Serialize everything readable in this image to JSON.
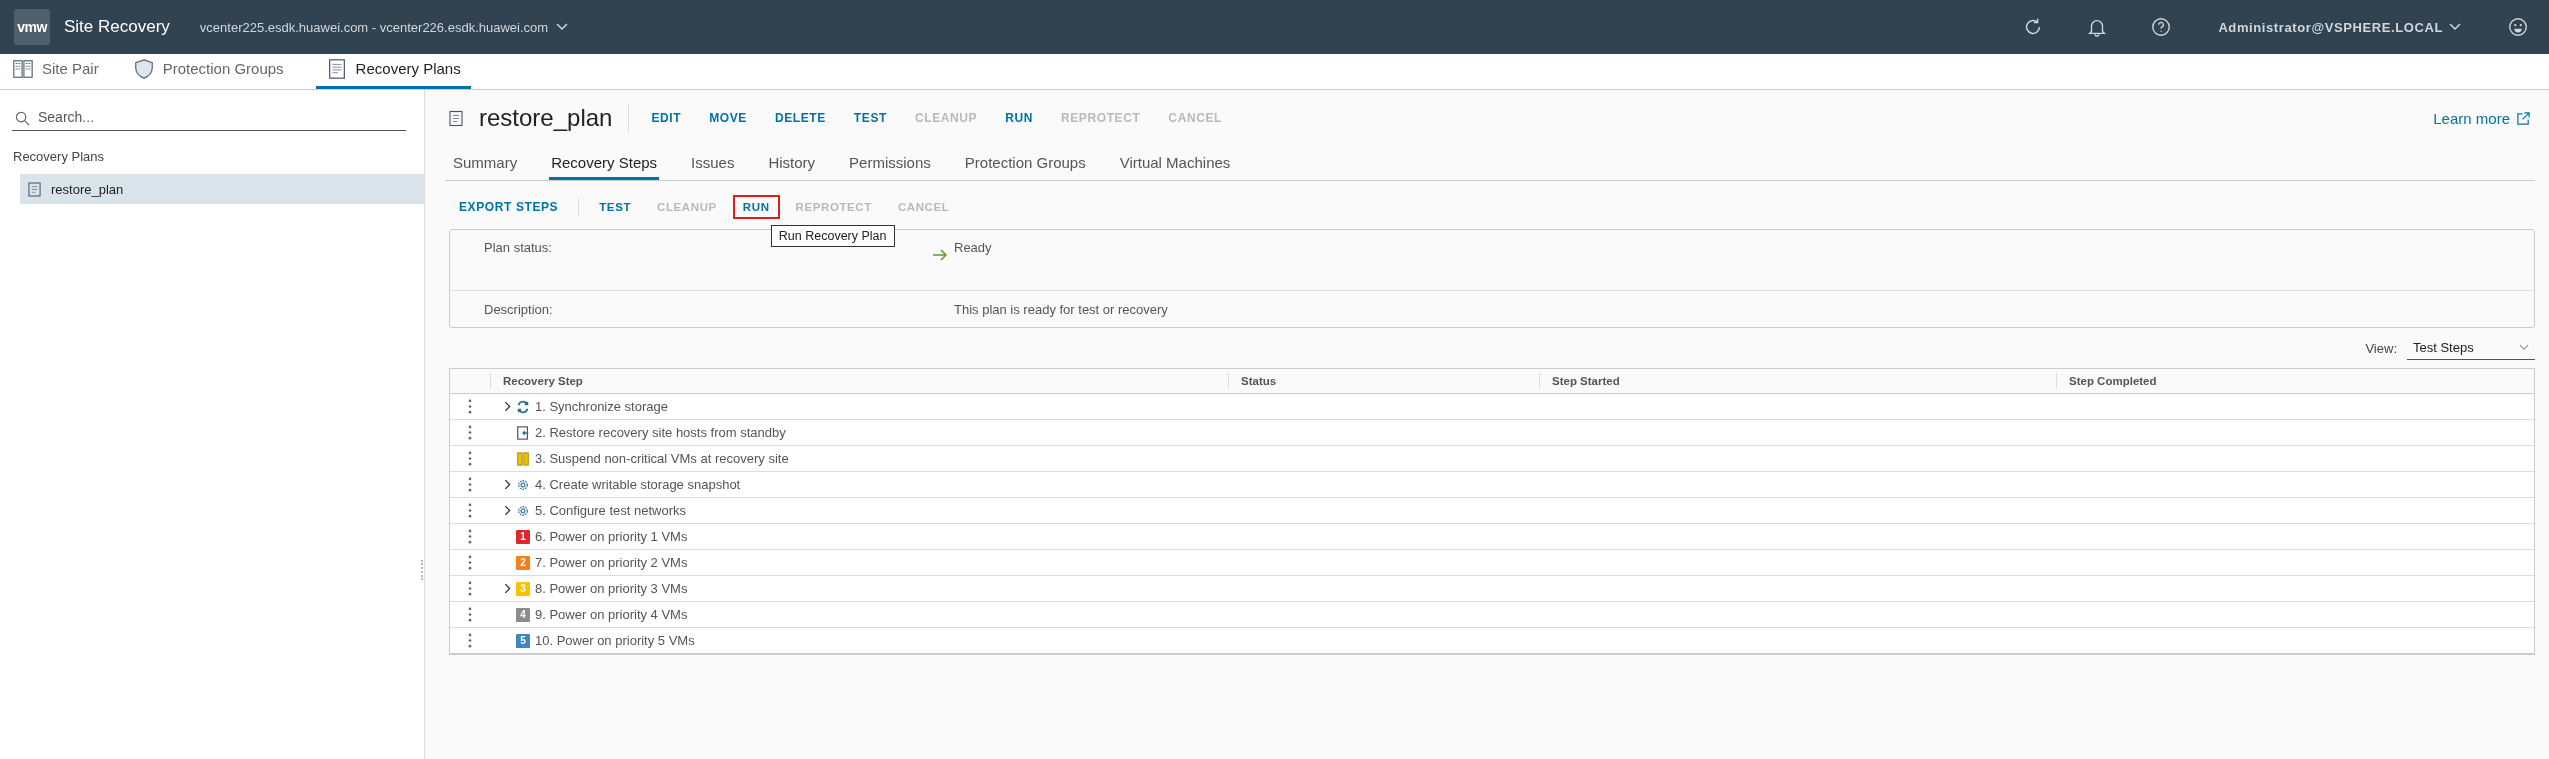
{
  "header": {
    "logo": "vmw",
    "app_title": "Site Recovery",
    "site_pair": "vcenter225.esdk.huawei.com - vcenter226.esdk.huawei.com",
    "user": "Administrator@VSPHERE.LOCAL"
  },
  "nav_tabs": [
    {
      "label": "Site Pair",
      "selected": false
    },
    {
      "label": "Protection Groups",
      "selected": false
    },
    {
      "label": "Recovery Plans",
      "selected": true
    }
  ],
  "sidebar": {
    "search": {
      "placeholder": "Search..."
    },
    "section": "Recovery Plans",
    "items": [
      {
        "label": "restore_plan",
        "selected": true
      }
    ]
  },
  "plan": {
    "title": "restore_plan",
    "actions": [
      {
        "label": "EDIT",
        "disabled": false
      },
      {
        "label": "MOVE",
        "disabled": false
      },
      {
        "label": "DELETE",
        "disabled": false
      },
      {
        "label": "TEST",
        "disabled": false
      },
      {
        "label": "CLEANUP",
        "disabled": true
      },
      {
        "label": "RUN",
        "disabled": false
      },
      {
        "label": "REPROTECT",
        "disabled": true
      },
      {
        "label": "CANCEL",
        "disabled": true
      }
    ],
    "learn_more": "Learn more",
    "tabs": [
      {
        "label": "Summary",
        "selected": false
      },
      {
        "label": "Recovery Steps",
        "selected": true
      },
      {
        "label": "Issues",
        "selected": false
      },
      {
        "label": "History",
        "selected": false
      },
      {
        "label": "Permissions",
        "selected": false
      },
      {
        "label": "Protection Groups",
        "selected": false
      },
      {
        "label": "Virtual Machines",
        "selected": false
      }
    ]
  },
  "steps_toolbar": {
    "export": "EXPORT STEPS",
    "actions": [
      {
        "label": "TEST",
        "disabled": false,
        "highlighted": false
      },
      {
        "label": "CLEANUP",
        "disabled": true,
        "highlighted": false
      },
      {
        "label": "RUN",
        "disabled": false,
        "highlighted": true
      },
      {
        "label": "REPROTECT",
        "disabled": true,
        "highlighted": false
      },
      {
        "label": "CANCEL",
        "disabled": true,
        "highlighted": false
      }
    ],
    "tooltip": "Run Recovery Plan"
  },
  "plan_info": {
    "status_label": "Plan status:",
    "status_value": "Ready",
    "description_label": "Description:",
    "description_value": "This plan is ready for test or recovery"
  },
  "view": {
    "label": "View:",
    "value": "Test Steps"
  },
  "table": {
    "columns": [
      "Recovery Step",
      "Status",
      "Step Started",
      "Step Completed"
    ],
    "rows": [
      {
        "step": "1. Synchronize storage",
        "expandable": true,
        "kind": "sync"
      },
      {
        "step": "2. Restore recovery site hosts from standby",
        "expandable": false,
        "kind": "host"
      },
      {
        "step": "3. Suspend non-critical VMs at recovery site",
        "expandable": false,
        "kind": "suspend"
      },
      {
        "step": "4. Create writable storage snapshot",
        "expandable": true,
        "kind": "gear"
      },
      {
        "step": "5. Configure test networks",
        "expandable": true,
        "kind": "gear"
      },
      {
        "step": "6. Power on priority 1 VMs",
        "expandable": false,
        "kind": "priority",
        "badge": "1",
        "color": "#db2a2a"
      },
      {
        "step": "7. Power on priority 2 VMs",
        "expandable": false,
        "kind": "priority",
        "badge": "2",
        "color": "#f57f1e"
      },
      {
        "step": "8. Power on priority 3 VMs",
        "expandable": true,
        "kind": "priority",
        "badge": "3",
        "color": "#f5c400"
      },
      {
        "step": "9. Power on priority 4 VMs",
        "expandable": false,
        "kind": "priority",
        "badge": "4",
        "color": "#8c8c8c"
      },
      {
        "step": "10. Power on priority 5 VMs",
        "expandable": false,
        "kind": "priority",
        "badge": "5",
        "color": "#3d87c4"
      }
    ]
  }
}
